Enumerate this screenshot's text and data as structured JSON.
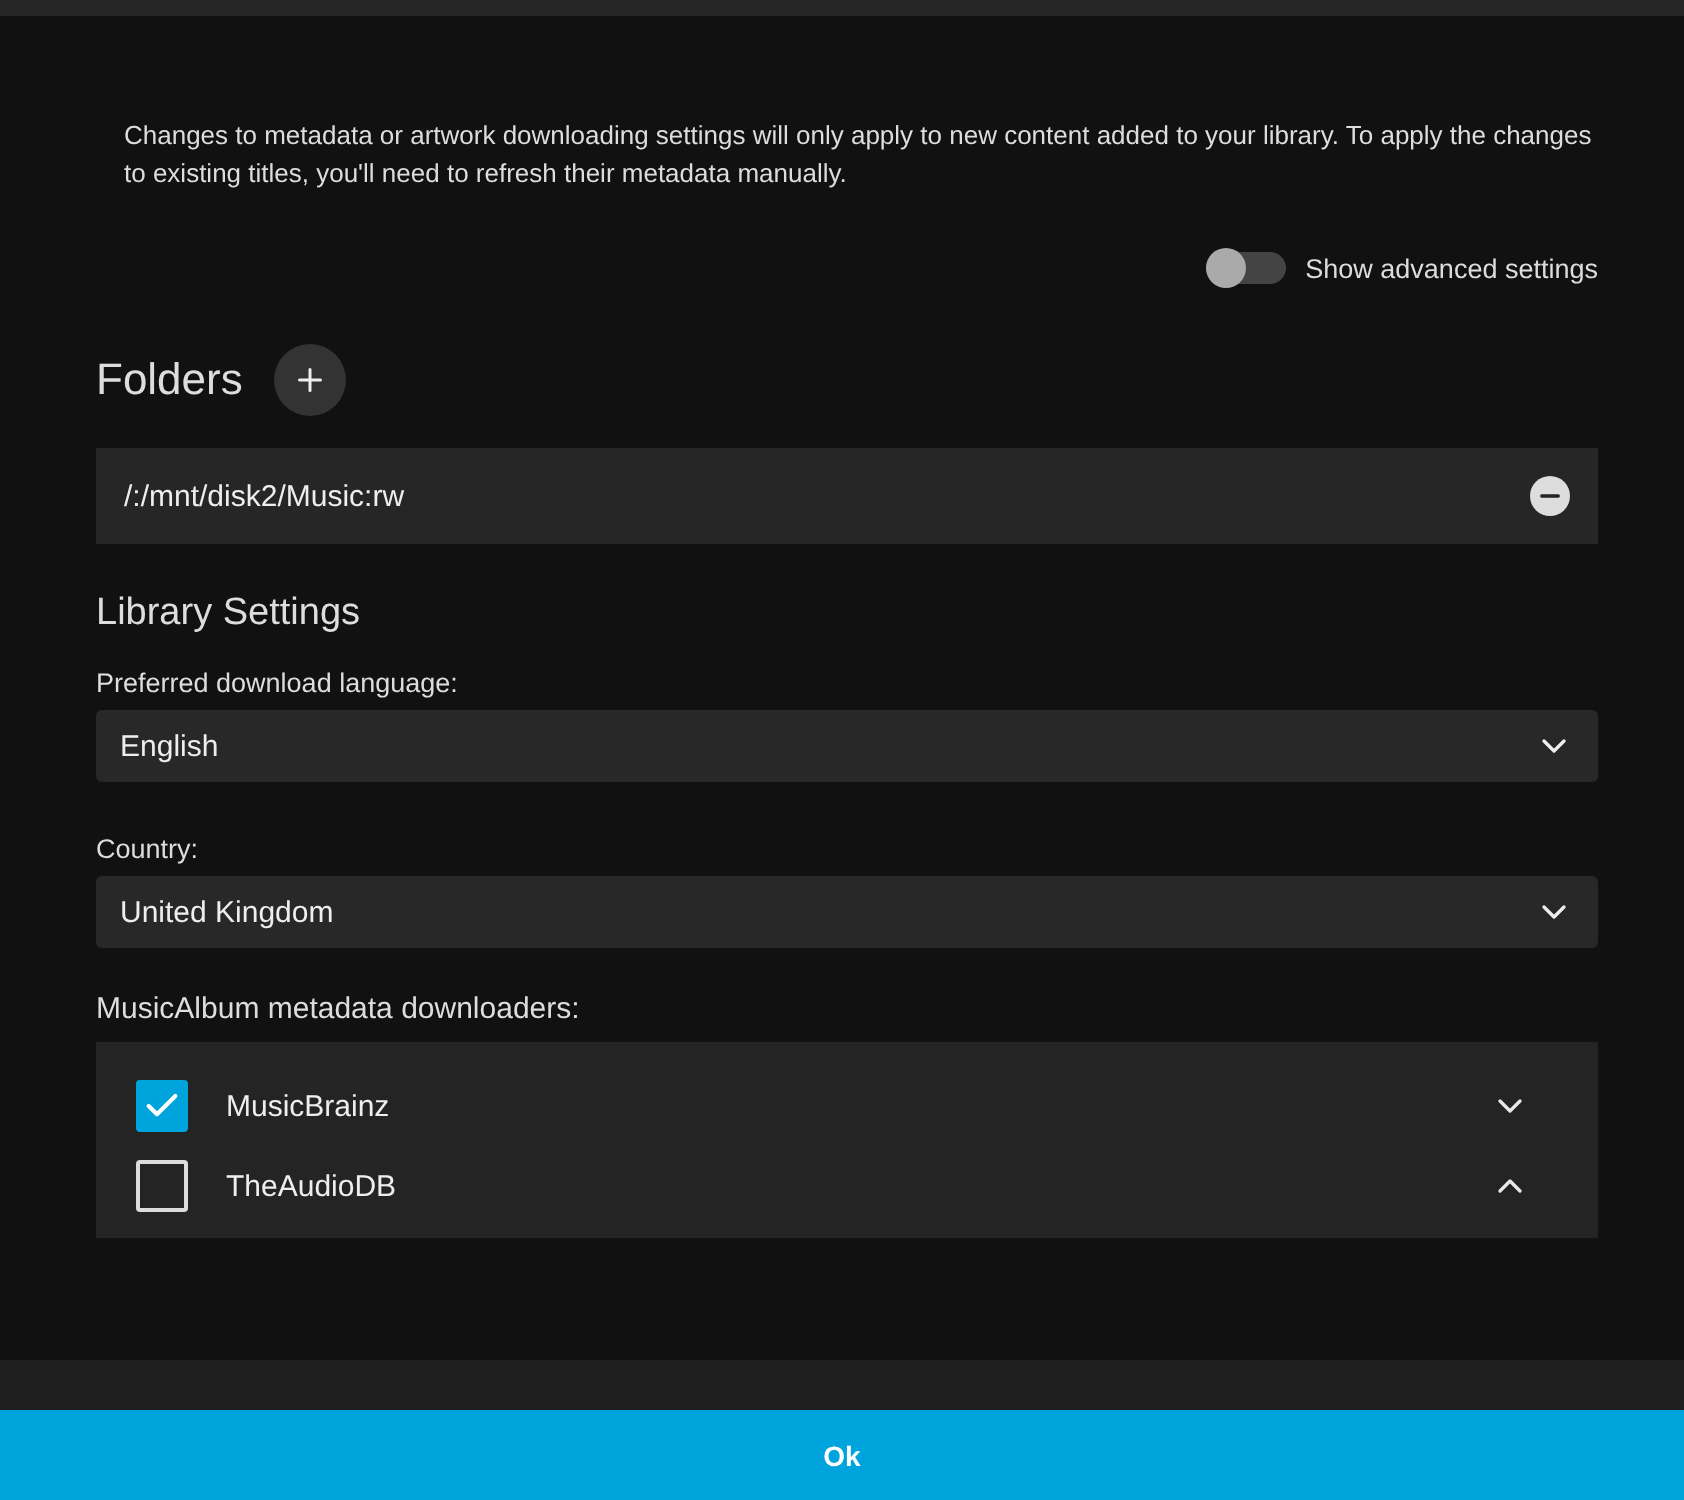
{
  "notice": "Changes to metadata or artwork downloading settings will only apply to new content added to your library. To apply the changes to existing titles, you'll need to refresh their metadata manually.",
  "advanced_toggle": {
    "label": "Show advanced settings",
    "on": false
  },
  "folders": {
    "title": "Folders",
    "items": [
      "/:/mnt/disk2/Music:rw"
    ]
  },
  "library_settings": {
    "title": "Library Settings",
    "fields": [
      {
        "label": "Preferred download language:",
        "value": "English"
      },
      {
        "label": "Country:",
        "value": "United Kingdom"
      }
    ]
  },
  "downloaders": {
    "label": "MusicAlbum metadata downloaders:",
    "items": [
      {
        "name": "MusicBrainz",
        "checked": true,
        "expanded": false
      },
      {
        "name": "TheAudioDB",
        "checked": false,
        "expanded": true
      }
    ]
  },
  "footer": {
    "button": "Ok"
  }
}
